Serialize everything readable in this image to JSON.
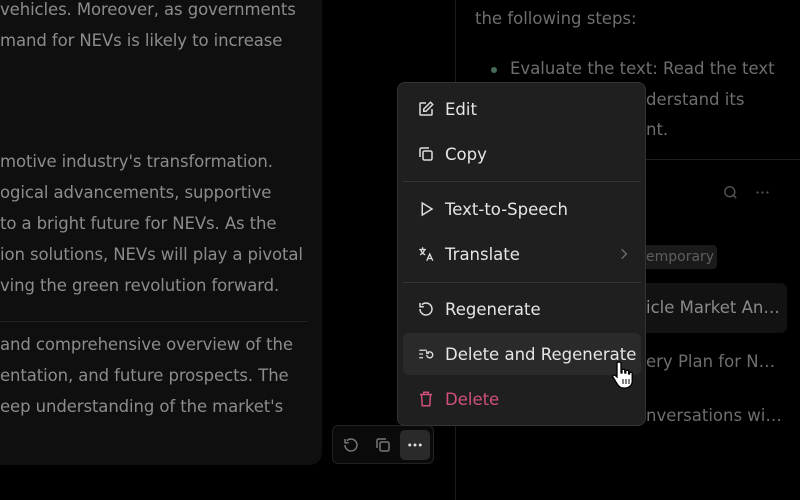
{
  "chat": {
    "lines": [
      "vehicles. Moreover, as governments",
      "mand for NEVs is likely to increase",
      "motive industry's transformation.",
      "ogical advancements, supportive",
      "to a bright future for NEVs. As the",
      "ion solutions, NEVs will play a pivotal",
      "ving the green revolution forward.",
      "and comprehensive overview of the",
      "entation, and future prospects. The",
      "eep understanding of the market's"
    ]
  },
  "actions": {
    "regenerate": "regenerate-icon",
    "copy": "copy-icon",
    "more": "more-icon"
  },
  "right_panel": {
    "lines": [
      "the following steps:",
      "Evaluate the text: Read the text",
      "derstand its",
      "nt."
    ],
    "tag": "emporary",
    "conversations": [
      "icle Market An…",
      "ery Plan for N…",
      "nversations wi…"
    ]
  },
  "menu": {
    "items": [
      {
        "label": "Edit",
        "icon": "edit-icon"
      },
      {
        "label": "Copy",
        "icon": "copy-icon"
      },
      {
        "label": "Text-to-Speech",
        "icon": "play-icon"
      },
      {
        "label": "Translate",
        "icon": "translate-icon"
      },
      {
        "label": "Regenerate",
        "icon": "regenerate-icon"
      },
      {
        "label": "Delete and Regenerate",
        "icon": "delete-regenerate-icon"
      },
      {
        "label": "Delete",
        "icon": "trash-icon"
      }
    ],
    "delete_color": "#d0507a"
  }
}
